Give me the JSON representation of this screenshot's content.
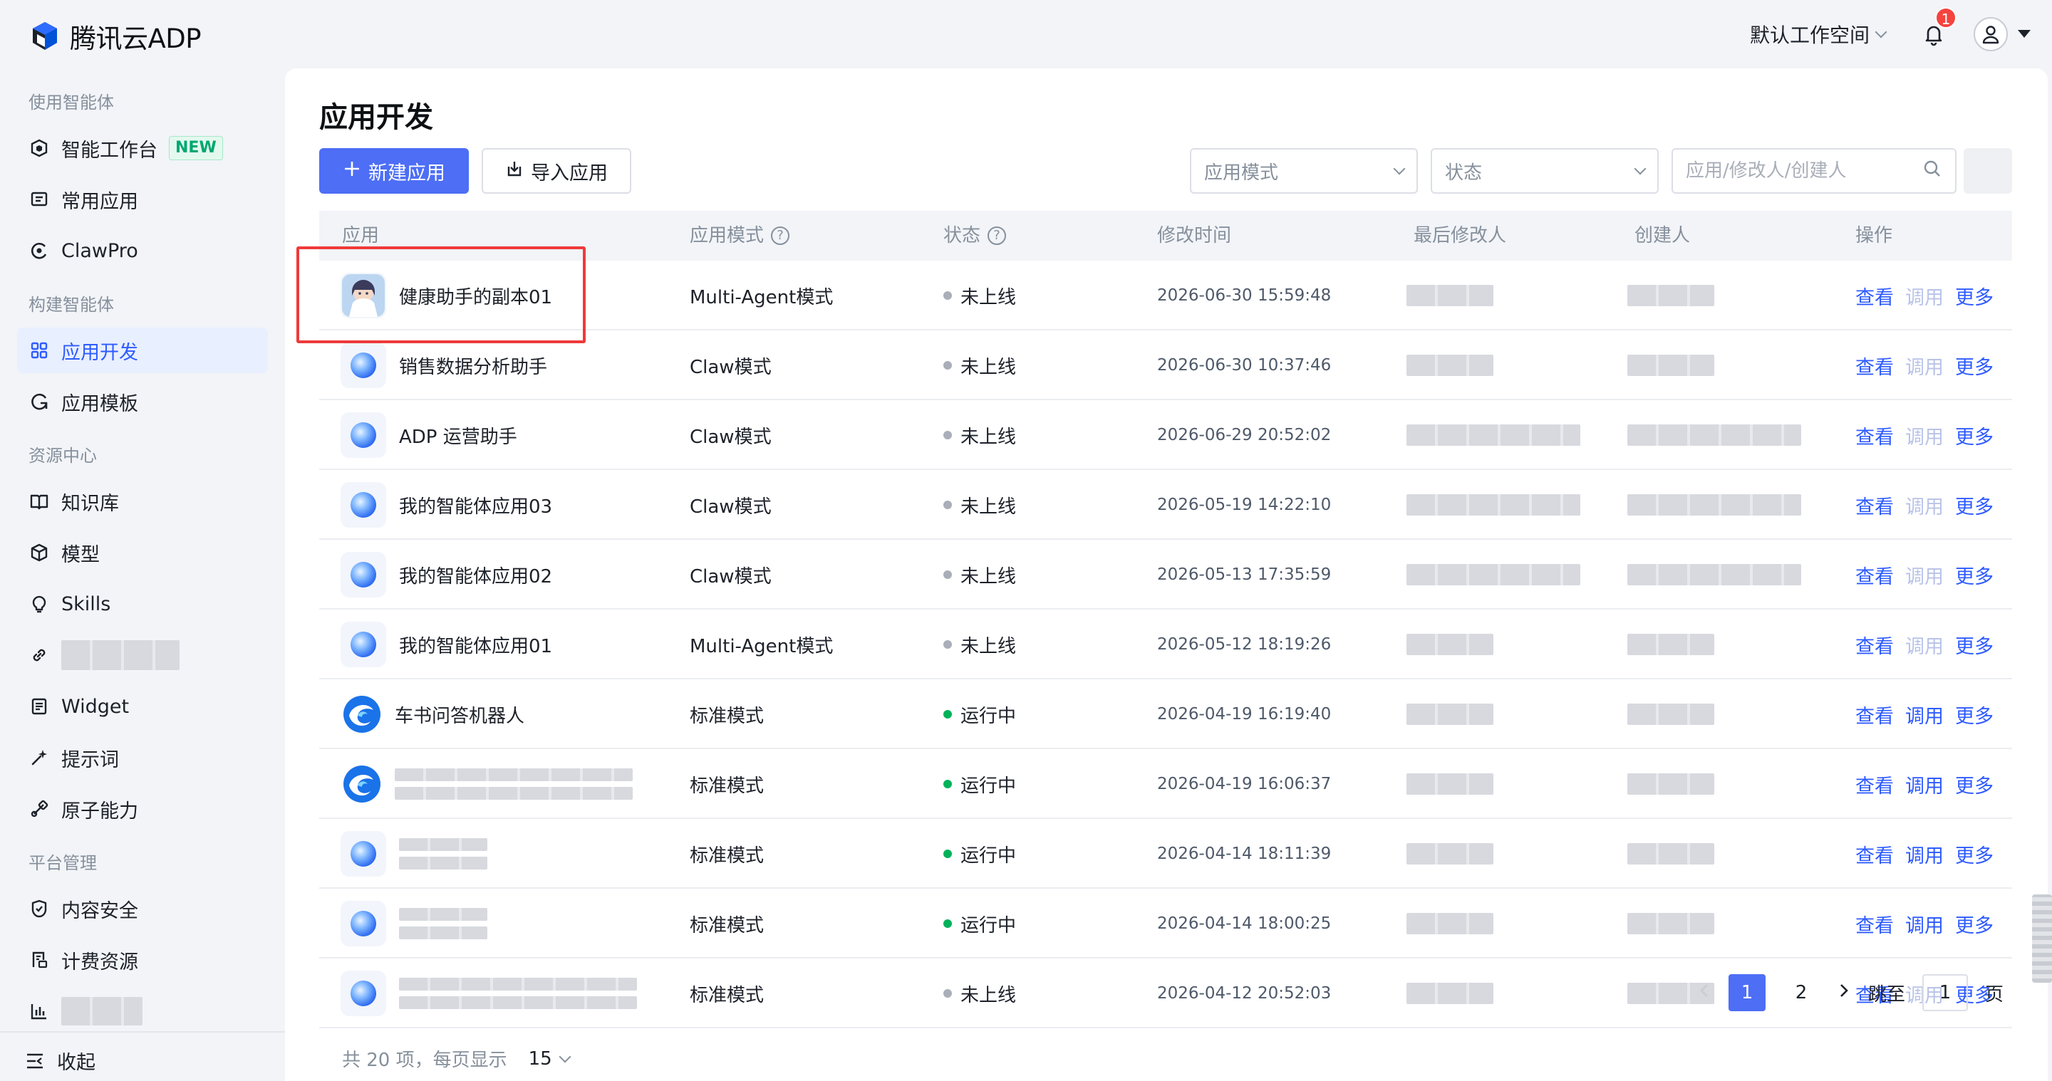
{
  "brand": {
    "name": "腾讯云ADP"
  },
  "header": {
    "workspace": "默认工作空间",
    "notification_count": "1"
  },
  "sidebar": {
    "groups": [
      {
        "label": "使用智能体"
      },
      {
        "label": "构建智能体"
      },
      {
        "label": "资源中心"
      },
      {
        "label": "平台管理"
      }
    ],
    "items": [
      {
        "label": "智能工作台",
        "icon": "workbench-icon",
        "badge": "NEW"
      },
      {
        "label": "常用应用",
        "icon": "message-square-icon"
      },
      {
        "label": "ClawPro",
        "icon": "claw-icon"
      },
      {
        "label": "应用开发",
        "icon": "grid-icon",
        "active": true
      },
      {
        "label": "应用模板",
        "icon": "template-icon"
      },
      {
        "label": "知识库",
        "icon": "book-icon"
      },
      {
        "label": "模型",
        "icon": "cube-icon"
      },
      {
        "label": "Skills",
        "icon": "lightbulb-icon"
      },
      {
        "label": "",
        "icon": "link-icon",
        "blurred": true
      },
      {
        "label": "Widget",
        "icon": "widget-icon"
      },
      {
        "label": "提示词",
        "icon": "sparkle-icon"
      },
      {
        "label": "原子能力",
        "icon": "atom-icon"
      },
      {
        "label": "内容安全",
        "icon": "shield-icon"
      },
      {
        "label": "计费资源",
        "icon": "billing-icon"
      },
      {
        "label": "",
        "icon": "bar-chart-icon",
        "blurred": true
      }
    ],
    "collapse_label": "收起"
  },
  "main": {
    "title": "应用开发",
    "create_button": "新建应用",
    "import_button": "导入应用",
    "filter_mode_placeholder": "应用模式",
    "filter_status_placeholder": "状态",
    "search_placeholder": "应用/修改人/创建人",
    "columns": {
      "app": "应用",
      "mode": "应用模式",
      "status": "状态",
      "modified": "修改时间",
      "last_editor": "最后修改人",
      "creator": "创建人",
      "actions": "操作"
    },
    "actions": {
      "view": "查看",
      "debug": "调用",
      "more": "更多"
    },
    "rows": [
      {
        "name": "健康助手的副本01",
        "icon": "avatar-doctor-icon",
        "mode": "Multi-Agent模式",
        "status": "未上线",
        "status_color": "#a9aeb8",
        "time": "2026-06-30 15:59:48",
        "debug_enabled": false
      },
      {
        "name": "销售数据分析助手",
        "icon": "orb-icon",
        "mode": "Claw模式",
        "status": "未上线",
        "status_color": "#a9aeb8",
        "time": "2026-06-30 10:37:46",
        "debug_enabled": false
      },
      {
        "name": "ADP 运营助手",
        "icon": "orb-icon",
        "mode": "Claw模式",
        "status": "未上线",
        "status_color": "#a9aeb8",
        "time": "2026-06-29 20:52:02",
        "debug_enabled": false
      },
      {
        "name": "我的智能体应用03",
        "icon": "orb-icon",
        "mode": "Claw模式",
        "status": "未上线",
        "status_color": "#a9aeb8",
        "time": "2026-05-19 14:22:10",
        "debug_enabled": false
      },
      {
        "name": "我的智能体应用02",
        "icon": "orb-icon",
        "mode": "Claw模式",
        "status": "未上线",
        "status_color": "#a9aeb8",
        "time": "2026-05-13 17:35:59",
        "debug_enabled": false
      },
      {
        "name": "我的智能体应用01",
        "icon": "orb-icon",
        "mode": "Multi-Agent模式",
        "status": "未上线",
        "status_color": "#a9aeb8",
        "time": "2026-05-12 18:19:26",
        "debug_enabled": false
      },
      {
        "name": "车书问答机器人",
        "icon": "swirl-icon",
        "mode": "标准模式",
        "status": "运行中",
        "status_color": "#00b25a",
        "time": "2026-04-19 16:19:40",
        "debug_enabled": true
      },
      {
        "name": "",
        "icon": "swirl-icon",
        "mode": "标准模式",
        "status": "运行中",
        "status_color": "#00b25a",
        "time": "2026-04-19 16:06:37",
        "debug_enabled": true,
        "blurred": true
      },
      {
        "name": "",
        "icon": "orb-icon",
        "mode": "标准模式",
        "status": "运行中",
        "status_color": "#00b25a",
        "time": "2026-04-14 18:11:39",
        "debug_enabled": true,
        "blurred": true
      },
      {
        "name": "",
        "icon": "orb-icon",
        "mode": "标准模式",
        "status": "运行中",
        "status_color": "#00b25a",
        "time": "2026-04-14 18:00:25",
        "debug_enabled": true,
        "blurred": true
      },
      {
        "name": "",
        "icon": "orb-icon",
        "mode": "标准模式",
        "status": "未上线",
        "status_color": "#a9aeb8",
        "time": "2026-04-12 20:52:03",
        "debug_enabled": false,
        "blurred": true
      }
    ],
    "pagination": {
      "total": "共 20 项，每页显示",
      "page_size": "15",
      "pages": [
        "1",
        "2"
      ],
      "current": "1",
      "jump_label": "跳至",
      "jump_value": "1",
      "page_suffix": "页"
    }
  }
}
